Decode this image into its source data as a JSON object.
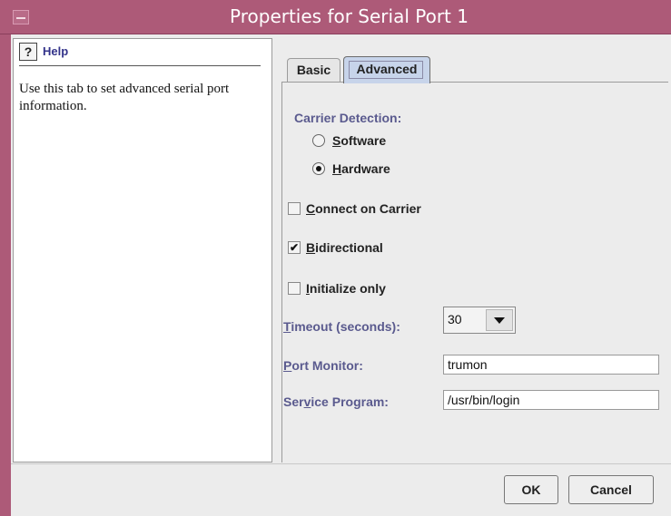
{
  "window": {
    "title": "Properties for Serial Port 1",
    "accent_color": "#ad5a78"
  },
  "help": {
    "icon": "help-question-icon",
    "label": "Help",
    "text": "Use this tab to set advanced serial port information."
  },
  "tabs": [
    {
      "label": "Basic",
      "selected": false
    },
    {
      "label": "Advanced",
      "selected": true
    }
  ],
  "carrier_detection": {
    "label": "Carrier Detection:",
    "options": [
      {
        "label": "Software",
        "mnemonic": "S",
        "rest": "oftware",
        "selected": false
      },
      {
        "label": "Hardware",
        "mnemonic": "H",
        "rest": "ardware",
        "selected": true
      }
    ]
  },
  "checkboxes": [
    {
      "label": "Connect on Carrier",
      "mnemonic": "C",
      "rest": "onnect on Carrier",
      "checked": false
    },
    {
      "label": "Bidirectional",
      "mnemonic": "B",
      "rest": "idirectional",
      "checked": true
    },
    {
      "label": "Initialize only",
      "mnemonic": "I",
      "rest": "nitialize only",
      "checked": false
    }
  ],
  "timeout": {
    "label_mnemonic": "T",
    "label_rest": "imeout (seconds):",
    "value": "30"
  },
  "port_monitor": {
    "label_mnemonic": "P",
    "label_rest": "ort Monitor:",
    "value": "trumon"
  },
  "service_program": {
    "label_pre": "Ser",
    "label_mnemonic": "v",
    "label_rest": "ice Program:",
    "value": "/usr/bin/login"
  },
  "buttons": {
    "ok": "OK",
    "cancel": "Cancel"
  }
}
